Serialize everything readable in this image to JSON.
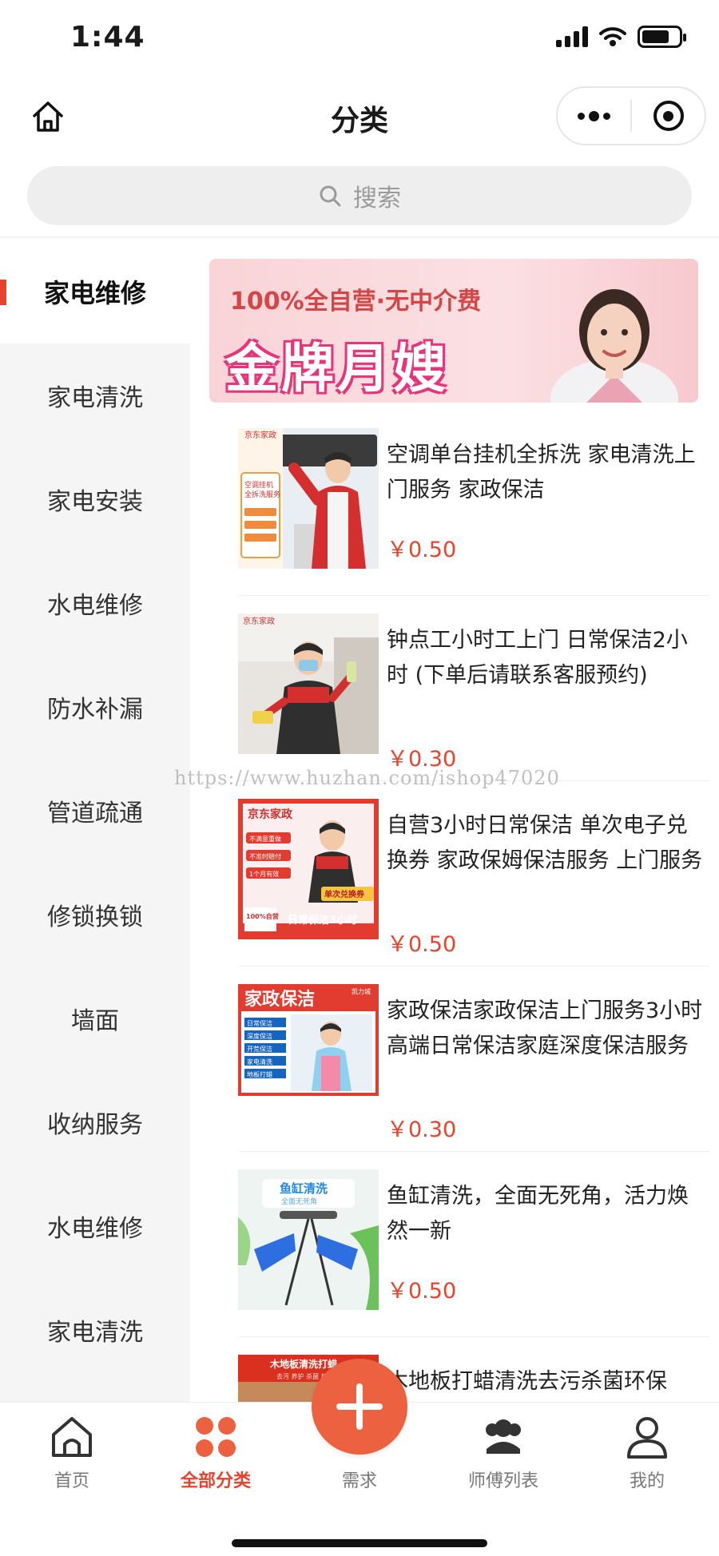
{
  "status": {
    "time": "1:44"
  },
  "nav": {
    "title": "分类"
  },
  "search": {
    "placeholder": "搜索"
  },
  "sidebar": {
    "items": [
      {
        "label": "家电维修"
      },
      {
        "label": "家电清洗"
      },
      {
        "label": "家电安装"
      },
      {
        "label": "水电维修"
      },
      {
        "label": "防水补漏"
      },
      {
        "label": "管道疏通"
      },
      {
        "label": "修锁换锁"
      },
      {
        "label": "墙面"
      },
      {
        "label": "收纳服务"
      },
      {
        "label": "水电维修"
      },
      {
        "label": "家电清洗"
      }
    ]
  },
  "banner": {
    "subtitle": "100%全自营·无中介费",
    "title": "金牌月嫂"
  },
  "products": [
    {
      "title": "空调单台挂机全拆洗 家电清洗上门服务 家政保洁",
      "price": "￥0.50"
    },
    {
      "title": "钟点工小时工上门 日常保洁2小时 (下单后请联系客服预约)",
      "price": "￥0.30"
    },
    {
      "title": "自营3小时日常保洁 单次电子兑换券 家政保姆保洁服务 上门服务",
      "price": "￥0.50"
    },
    {
      "title": "家政保洁家政保洁上门服务3小时高端日常保洁家庭深度保洁服务",
      "price": "￥0.30"
    },
    {
      "title": "鱼缸清洗，全面无死角，活力焕然一新",
      "price": "￥0.50"
    },
    {
      "title": "木地板打蜡清洗去污杀菌环保",
      "price": ""
    }
  ],
  "thumbs": {
    "t1": {
      "brand": "京东家政",
      "line1": "空调挂机",
      "line2": "全拆洗服务"
    },
    "t2": {
      "brand": "京东家政"
    },
    "t3": {
      "brand": "京东家政",
      "tag": "单次兑换券",
      "badge": "100%自营",
      "footer": "日常保洁3小时",
      "items": [
        "不满意重做",
        "不准时赔付",
        "1个月有效"
      ]
    },
    "t4": {
      "title": "家政保洁",
      "corner": "凯力城",
      "items": [
        "日常保洁",
        "深度保洁",
        "开荒保洁",
        "家电清洗",
        "地板打蜡"
      ]
    },
    "t5": {
      "title": "鱼缸清洗",
      "sub": "全面无死角"
    },
    "t6": {
      "title": "木地板清洗打蜡",
      "sub": "去污 养护 杀菌 打蜡"
    }
  },
  "watermark": "https://www.huzhan.com/ishop47020",
  "tabs": [
    {
      "label": "首页"
    },
    {
      "label": "全部分类"
    },
    {
      "label": "需求"
    },
    {
      "label": "师傅列表"
    },
    {
      "label": "我的"
    }
  ],
  "colors": {
    "accent": "#e8432c",
    "fab": "#ec6240"
  }
}
